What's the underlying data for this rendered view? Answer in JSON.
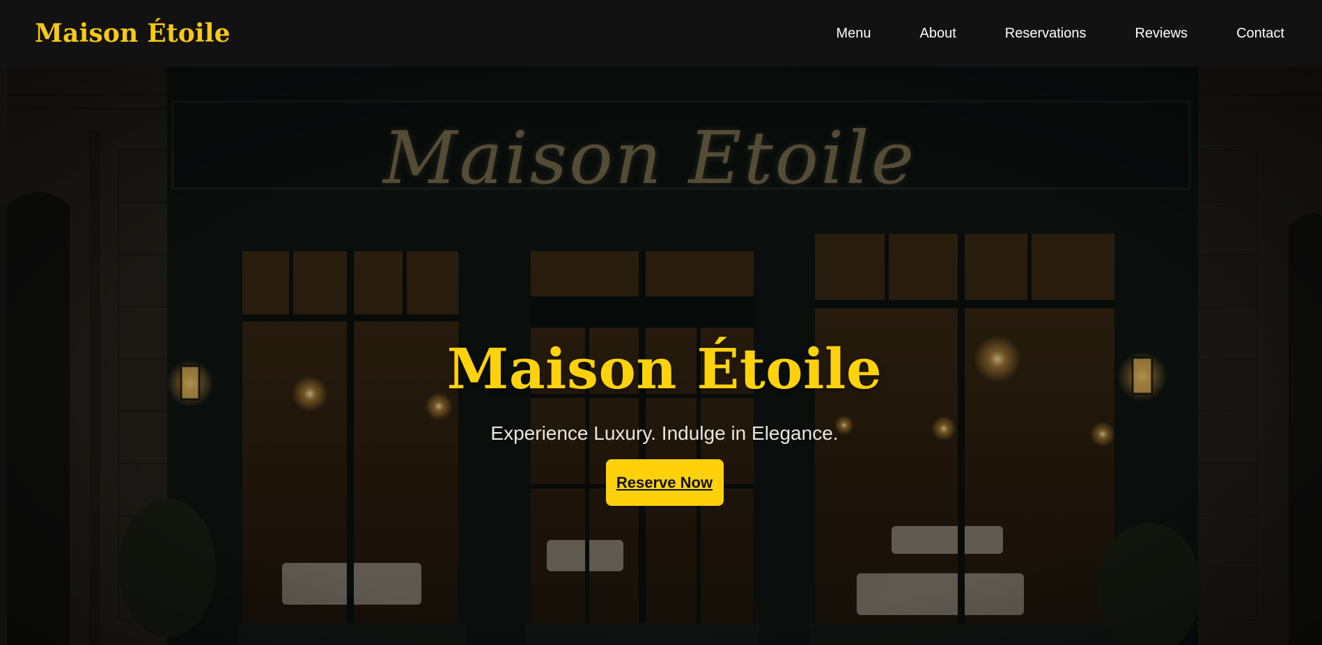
{
  "header": {
    "brand": "Maison Étoile",
    "nav": [
      {
        "label": "Menu"
      },
      {
        "label": "About"
      },
      {
        "label": "Reservations"
      },
      {
        "label": "Reviews"
      },
      {
        "label": "Contact"
      }
    ]
  },
  "hero": {
    "sign_text": "Maison Etoile",
    "title": "Maison Étoile",
    "tagline": "Experience Luxury. Indulge in Elegance.",
    "cta_label": "Reserve Now"
  },
  "colors": {
    "accent": "#ffd10b",
    "brand": "#f6c914",
    "nav_background": "#121212",
    "nav_text": "#ffffff"
  }
}
